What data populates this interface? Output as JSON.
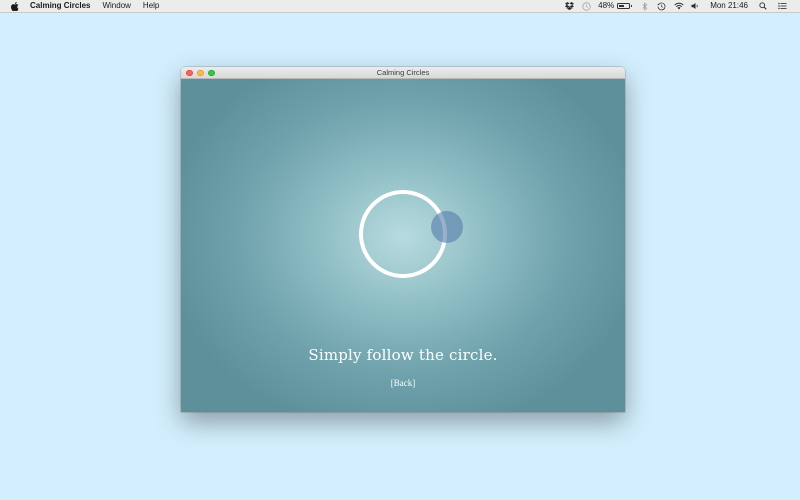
{
  "menubar": {
    "apple_icon": "apple-logo-icon",
    "app_name": "Calming Circles",
    "menus": [
      "Window",
      "Help"
    ],
    "status": {
      "icons": [
        "dropbox-icon",
        "sync-icon",
        "battery-icon",
        "bluetooth-icon",
        "time-machine-icon",
        "wifi-icon",
        "volume-icon",
        "spotlight-search-icon",
        "notification-center-icon"
      ],
      "battery_percent": "48%",
      "battery_level": 0.48,
      "clock": "Mon 21:46"
    }
  },
  "window": {
    "title": "Calming Circles",
    "instruction": "Simply follow the circle.",
    "back_label": "[Back]"
  },
  "colors": {
    "desktop": "#d3effd",
    "content_center": "#b8dbdf",
    "content_edge": "#5e909b",
    "ring": "#ffffff",
    "dot": "#5880ac"
  }
}
